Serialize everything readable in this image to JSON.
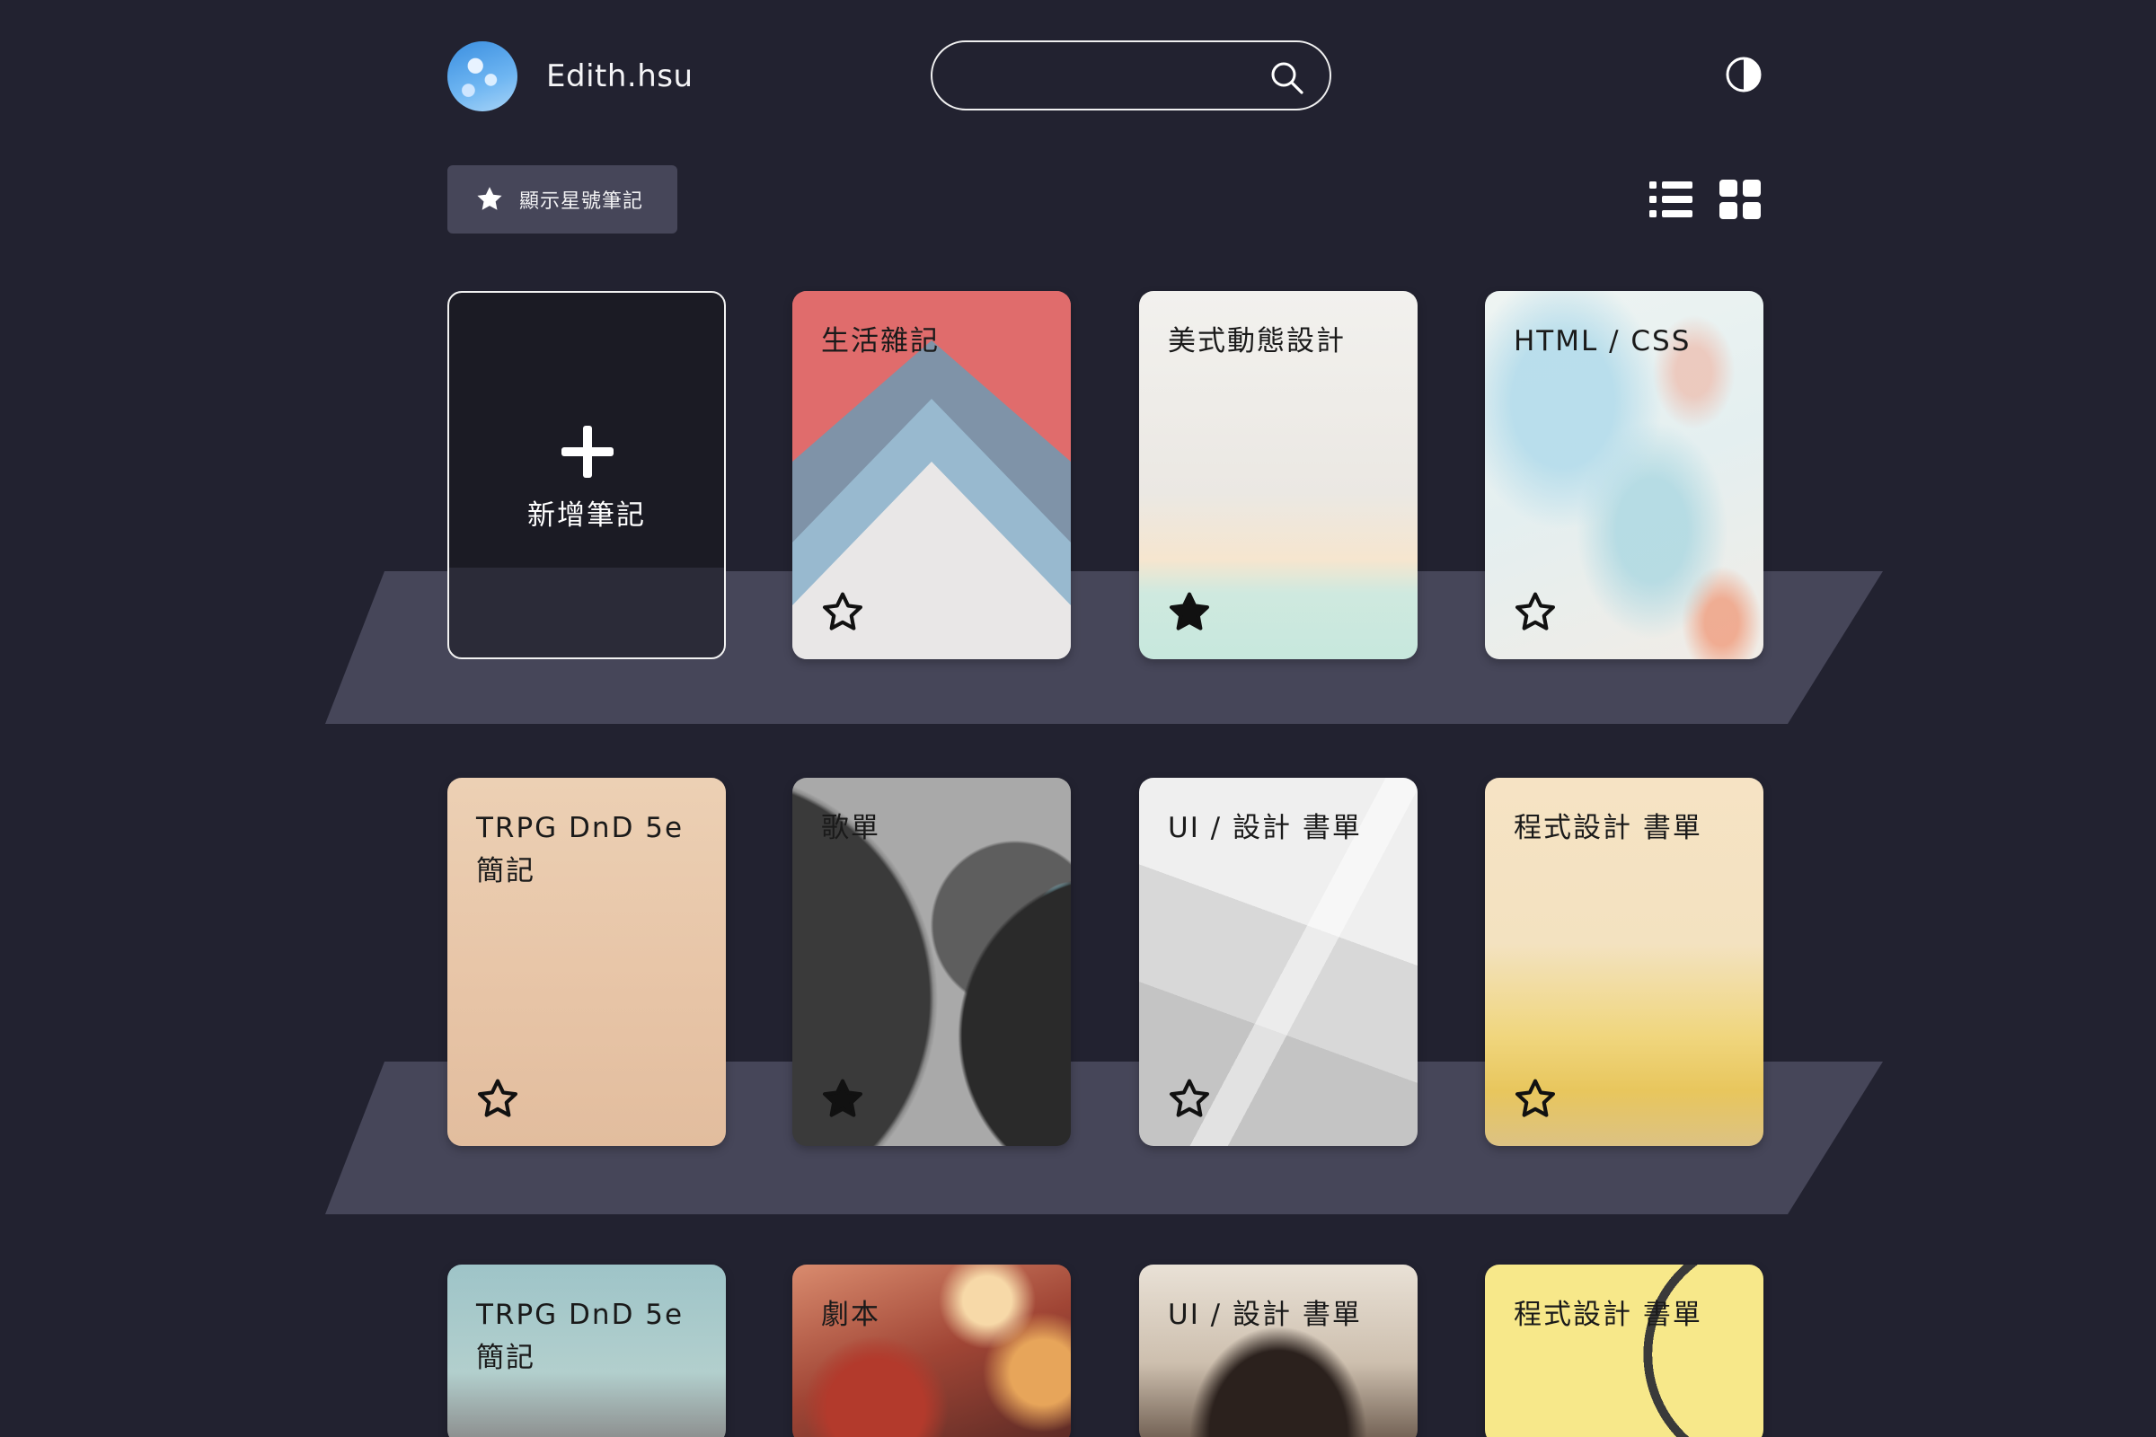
{
  "user": {
    "name": "Edith.hsu"
  },
  "search": {
    "placeholder": ""
  },
  "toolbar": {
    "starred_label": "顯示星號筆記"
  },
  "add_card": {
    "label": "新增筆記"
  },
  "notes": [
    {
      "title": "生活雜記",
      "starred": false
    },
    {
      "title": "美式動態設計",
      "starred": true
    },
    {
      "title": "HTML / CSS",
      "starred": false
    },
    {
      "title": "TRPG  DnD  5e 簡記",
      "starred": false
    },
    {
      "title": "歌單",
      "starred": true
    },
    {
      "title": "UI / 設計 書單",
      "starred": false
    },
    {
      "title": "程式設計 書單",
      "starred": false
    },
    {
      "title": "TRPG  DnD  5e 簡記",
      "starred": false
    },
    {
      "title": "劇本",
      "starred": false
    },
    {
      "title": "UI / 設計 書單",
      "starred": false
    },
    {
      "title": "程式設計 書單",
      "starred": false
    }
  ],
  "colors": {
    "background": "#222230",
    "shelf": "#464659",
    "button_bg": "#464659"
  },
  "icons": [
    "search-icon",
    "contrast-toggle-icon",
    "star-icon",
    "list-view-icon",
    "grid-view-icon",
    "plus-icon"
  ]
}
